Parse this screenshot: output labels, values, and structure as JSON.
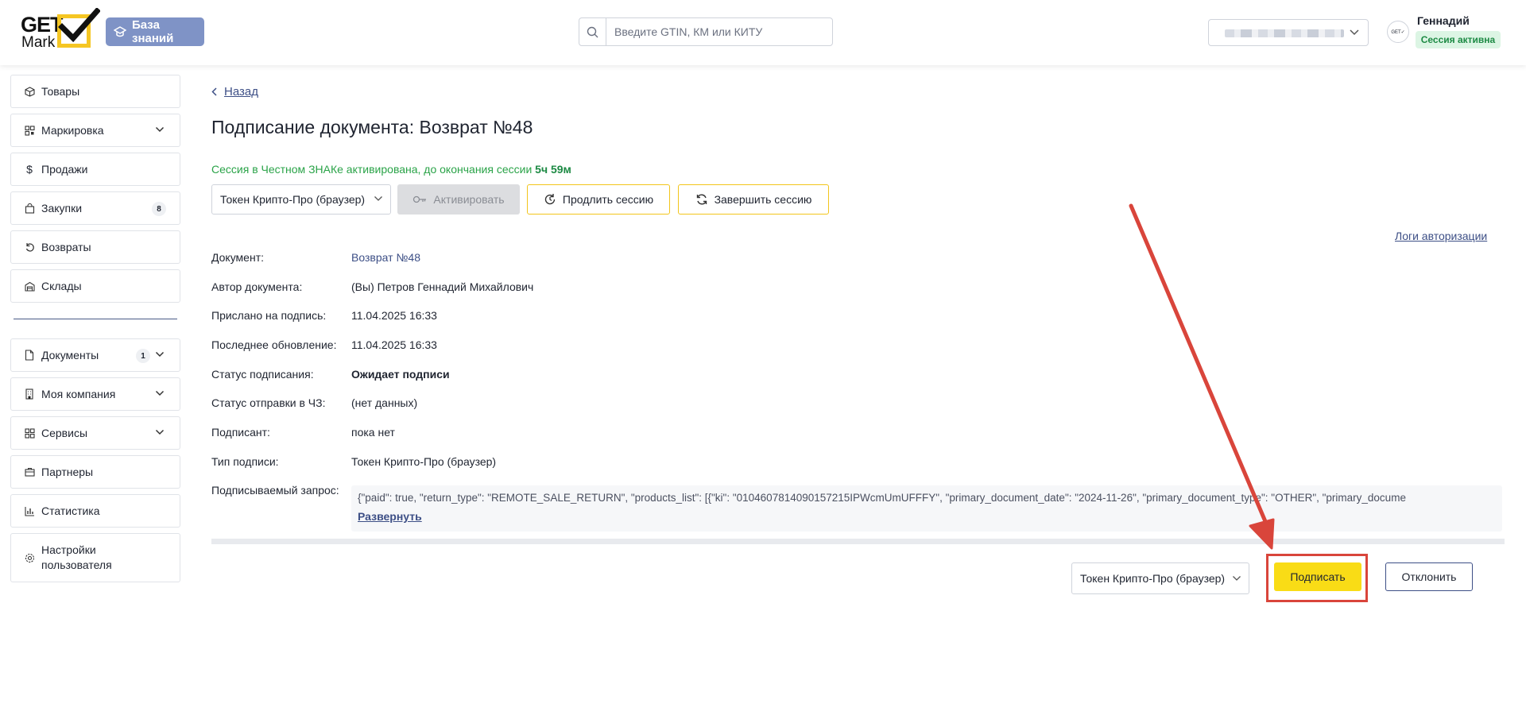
{
  "header": {
    "logo_top": "GET",
    "logo_bottom": "Mark",
    "kb_label": "База знаний",
    "search_placeholder": "Введите GTIN, КМ или КИТУ",
    "user_name": "Геннадий",
    "session_status": "Сессия активна",
    "avatar_text": "GET✓"
  },
  "sidebar": {
    "items": [
      {
        "label": "Товары",
        "icon": "box-icon"
      },
      {
        "label": "Маркировка",
        "icon": "qr-icon"
      },
      {
        "label": "Продажи",
        "icon": "dollar-icon"
      },
      {
        "label": "Закупки",
        "icon": "bag-icon",
        "count": "8"
      },
      {
        "label": "Возвраты",
        "icon": "return-icon"
      },
      {
        "label": "Склады",
        "icon": "warehouse-icon"
      },
      {
        "label": "Документы",
        "icon": "document-icon",
        "count": "1"
      },
      {
        "label": "Моя компания",
        "icon": "building-icon"
      },
      {
        "label": "Сервисы",
        "icon": "grid-icon"
      },
      {
        "label": "Партнеры",
        "icon": "partners-icon"
      },
      {
        "label": "Статистика",
        "icon": "chart-icon"
      },
      {
        "label": "Настройки пользователя",
        "icon": "gear-icon"
      }
    ]
  },
  "main": {
    "back_label": "Назад",
    "title": "Подписание документа: Возврат №48",
    "session_text": "Сессия в Честном ЗНАКе активирована, до окончания сессии ",
    "session_remaining": "5ч 59м",
    "token_select": "Токен Крипто-Про (браузер)",
    "activate_label": "Активировать",
    "extend_label": "Продлить сессию",
    "end_label": "Завершить сессию",
    "logs_label": "Логи авторизации",
    "info": {
      "document_label": "Документ:",
      "document_value": "Возврат №48",
      "author_label": "Автор документа:",
      "author_value": "(Вы) Петров Геннадий Михайлович",
      "sent_label": "Прислано на подпись:",
      "sent_value": "11.04.2025 16:33",
      "updated_label": "Последнее обновление:",
      "updated_value": "11.04.2025 16:33",
      "sign_status_label": "Статус подписания:",
      "sign_status_value": "Ожидает подписи",
      "send_status_label": "Статус отправки в ЧЗ:",
      "send_status_value": "(нет данных)",
      "signer_label": "Подписант:",
      "signer_value": "пока нет",
      "sign_type_label": "Тип подписи:",
      "sign_type_value": "Токен Крипто-Про (браузер)",
      "request_label": "Подписываемый запрос:",
      "request_value": "{\"paid\": true, \"return_type\": \"REMOTE_SALE_RETURN\", \"products_list\": [{\"ki\": \"0104607814090157215IPWcmUmUFFFY\", \"primary_document_date\": \"2024-11-26\", \"primary_document_type\": \"OTHER\", \"primary_docume",
      "expand_label": "Развернуть"
    },
    "bottom_token_select": "Токен Крипто-Про (браузер)",
    "sign_label": "Подписать",
    "reject_label": "Отклонить"
  },
  "colors": {
    "accent_yellow": "#f9dc16",
    "brand_blue": "#3d4f86",
    "success_green": "#2aa348",
    "annotation_red": "#d9453b"
  }
}
